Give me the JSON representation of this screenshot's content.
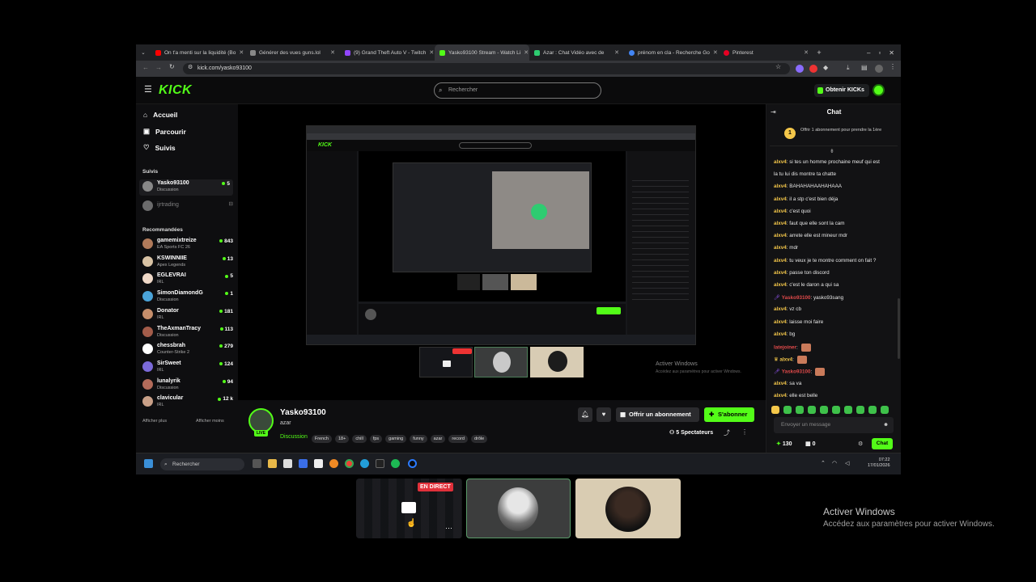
{
  "tabs": [
    {
      "label": "On t'a menti sur la liquidité (Bo",
      "color": "#ff0000"
    },
    {
      "label": "Générer des vues guns.lol",
      "color": "#888888"
    },
    {
      "label": "(9) Grand Theft Auto V - Twitch",
      "color": "#9146ff"
    },
    {
      "label": "Yasko93100 Stream - Watch Li",
      "color": "#53fc18"
    },
    {
      "label": "Azar : Chat Vidéo avec de",
      "color": "#2ecc71"
    },
    {
      "label": "prénom en cla - Recherche Go",
      "color": "#4285f4"
    },
    {
      "label": "Pinterest",
      "color": "#e60023"
    }
  ],
  "url": "kick.com/yasko93100",
  "header": {
    "logo": "KICK",
    "search_placeholder": "Rechercher",
    "kicks_button": "Obtenir KICKs"
  },
  "nav": [
    {
      "label": "Accueil",
      "icon": "home-icon"
    },
    {
      "label": "Parcourir",
      "icon": "browse-icon"
    },
    {
      "label": "Suivis",
      "icon": "heart-icon"
    }
  ],
  "followed_title": "Suivis",
  "followed": [
    {
      "name": "Yasko93100",
      "category": "Discussion",
      "viewers": "5"
    },
    {
      "name": "ijrtrading",
      "category": "",
      "viewers": ""
    }
  ],
  "recommended_title": "Recommandées",
  "recommended": [
    {
      "name": "gamemixtreize",
      "category": "EA Sports FC 26",
      "viewers": "843"
    },
    {
      "name": "KSWINNIIE",
      "category": "Apex Legends",
      "viewers": "13"
    },
    {
      "name": "EGLEVRAI",
      "category": "IRL",
      "viewers": "5"
    },
    {
      "name": "SimonDiamondG",
      "category": "Discussion",
      "viewers": "1"
    },
    {
      "name": "Donator",
      "category": "IRL",
      "viewers": "181"
    },
    {
      "name": "TheAxmanTracy",
      "category": "Discussion",
      "viewers": "113"
    },
    {
      "name": "chessbrah",
      "category": "Counter-Strike 2",
      "viewers": "279"
    },
    {
      "name": "SirSweet",
      "category": "IRL",
      "viewers": "124"
    },
    {
      "name": "lunalyrik",
      "category": "Discussion",
      "viewers": "94"
    },
    {
      "name": "clavicular",
      "category": "IRL",
      "viewers": "12 k"
    }
  ],
  "show_more": "Afficher plus",
  "show_less": "Afficher moins",
  "player_watermark": {
    "line1": "Activer Windows",
    "line2": "Accédez aux paramètres pour activer Windows."
  },
  "stream": {
    "channel": "Yasko93100",
    "title": "azar",
    "category": "Discussion",
    "live_badge": "LIVE",
    "tags": [
      "French",
      "18+",
      "chill",
      "fps",
      "gaming",
      "funny",
      "azar",
      "record",
      "drôle"
    ],
    "subscribe_gift": "Offrir un abonnement",
    "follow": "S'abonner",
    "viewers": "5 Spectateurs"
  },
  "chat": {
    "title": "Chat",
    "pinned": "Offrir 1 abonnement pour prendre la 1ère",
    "messages": [
      {
        "user": "alxv4",
        "text": "si tes un homme prochaine meuf qui est"
      },
      {
        "user": "",
        "text": "la tu lui dis montre ta chatte"
      },
      {
        "user": "alxv4",
        "text": "BAHAHAHAAHAHAAA"
      },
      {
        "user": "alxv4",
        "text": "il a stp c'est bien déja"
      },
      {
        "user": "alxv4",
        "text": "c'est quoi"
      },
      {
        "user": "alxv4",
        "text": "faut que elle sont la cam"
      },
      {
        "user": "alxv4",
        "text": "arrete elle est mineur mdr"
      },
      {
        "user": "alxv4",
        "text": "mdr"
      },
      {
        "user": "alxv4",
        "text": "tu veux je te montre comment on fait ?"
      },
      {
        "user": "alxv4",
        "text": "passe ton discord"
      },
      {
        "user": "alxv4",
        "text": "c'est le daron a qui sa"
      },
      {
        "user": "Yasko93100",
        "text": "yasko93sang"
      },
      {
        "user": "alxv4",
        "text": "vz cb"
      },
      {
        "user": "alxv4",
        "text": "laisse moi faire"
      },
      {
        "user": "alxv4",
        "text": "bg"
      },
      {
        "user": "latejoiner",
        "text": ""
      },
      {
        "user": "alxv4",
        "text": ""
      },
      {
        "user": "Yasko93100",
        "text": ""
      },
      {
        "user": "alxv4",
        "text": "sa va"
      },
      {
        "user": "alxv4",
        "text": "elle est belle"
      }
    ],
    "input_placeholder": "Envoyer un message",
    "points": "130",
    "gifts": "0",
    "send": "Chat"
  },
  "taskbar": {
    "search": "Rechercher",
    "time": "07:22",
    "date": "17/01/2026"
  },
  "bottom": {
    "live_label": "EN DIRECT"
  },
  "desktop_watermark": {
    "line1": "Activer Windows",
    "line2": "Accédez aux paramètres pour activer Windows."
  },
  "colors": {
    "accent": "#53fc18",
    "username": "#f4c74a",
    "bg": "#0e0e10"
  }
}
